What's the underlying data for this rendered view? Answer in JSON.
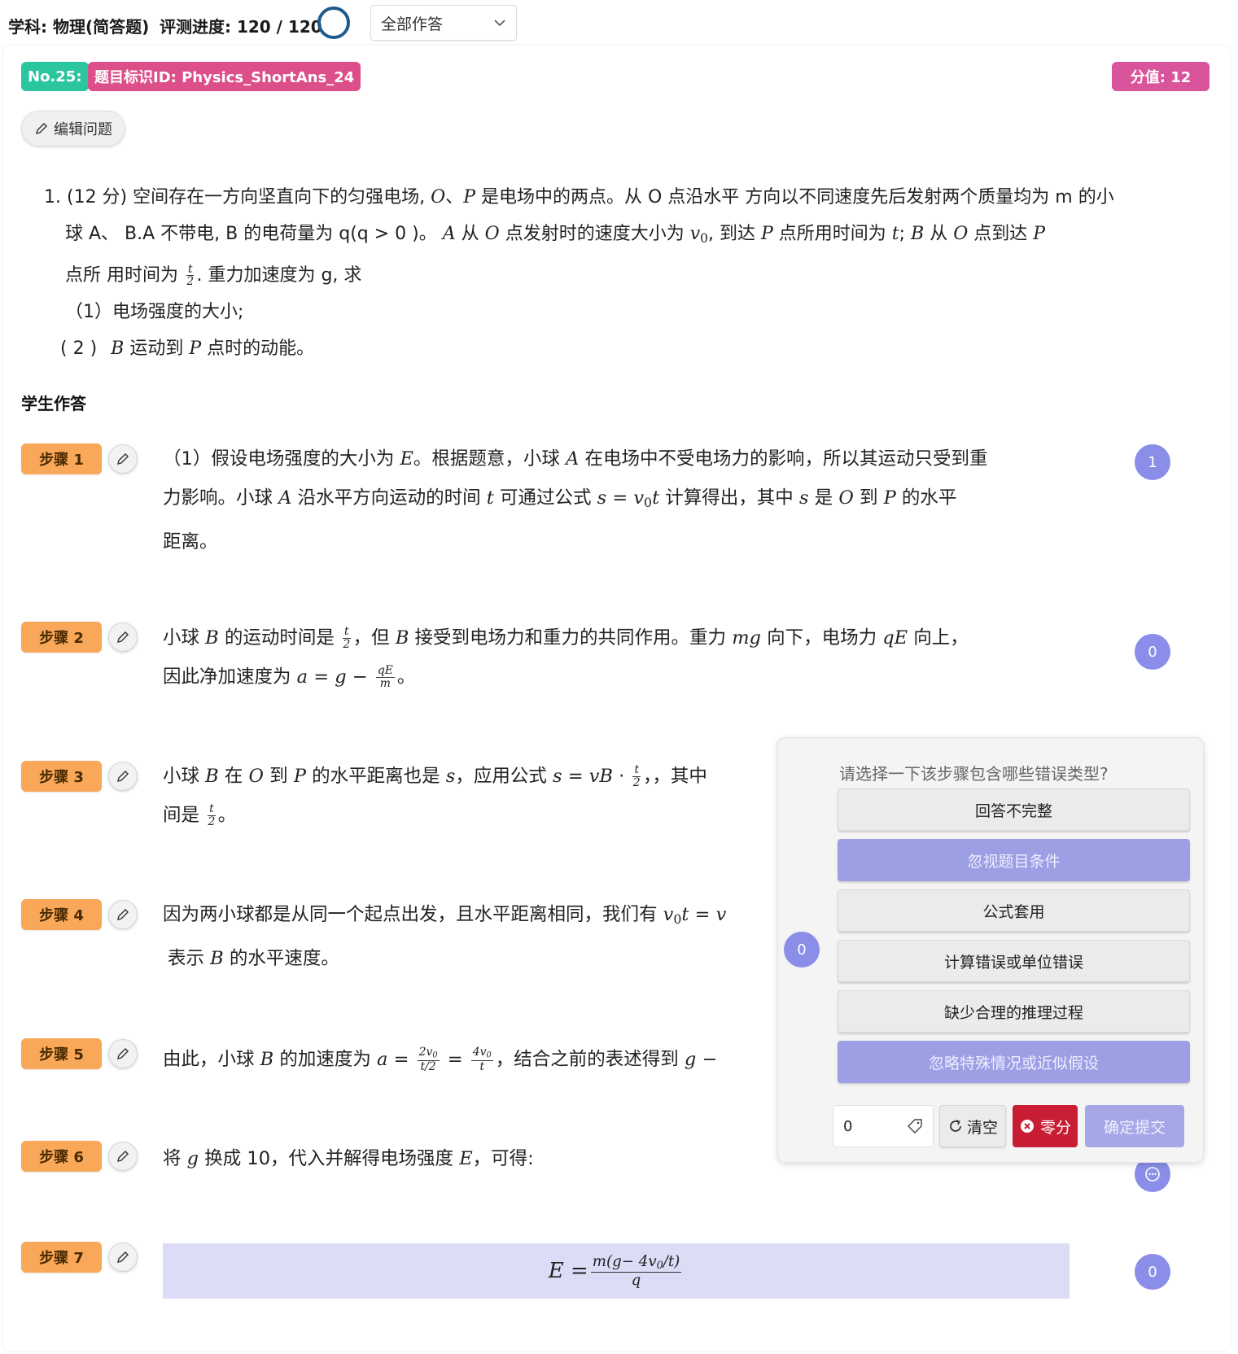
{
  "header": {
    "subject": "学科: 物理(简答题)",
    "progress": "评测进度: 120 / 120",
    "filter_value": "全部作答"
  },
  "question_card": {
    "number_tag": "No.25:",
    "id_tag": "题目标识ID: Physics_ShortAns_24",
    "score_tag": "分值: 12",
    "edit_button": "编辑问题"
  },
  "question": {
    "prefix": "1. (12 分) 空间存在一方向坚直向下的匀强电场,",
    "line1_b": "是电场中的两点。从 O 点沿水平 方向以不同速度先后发射两个质量均为 m 的小",
    "line2_a": "球 A、 B.A 不带电, B 的电荷量为 q(q > 0 )。",
    "line2_b": "从",
    "line2_c": "点发射时的速度大小为",
    "line2_d": ", 到达",
    "line2_e": "点所用时间为",
    "line2_f": "从",
    "line2_g": "点到达",
    "line3_a": "点所 用时间为",
    "line3_b": ". 重力加速度为 g, 求",
    "sub1": "（1）电场强度的大小;",
    "sub2_a": "( 2 )",
    "sub2_b": "运动到",
    "sub2_c": "点时的动能。"
  },
  "answers_title": "学生作答",
  "steps": [
    {
      "label": "步骤 1",
      "score": "1",
      "t1": "（1）假设电场强度的大小为",
      "t2": "。根据题意，小球",
      "t3": "在电场中不受电场力的影响，所以其运动只受到重",
      "t4": "力影响。小球",
      "t5": "沿水平方向运动的时间",
      "t6": "可通过公式",
      "t7": "计算得出，其中",
      "t8": "是",
      "t9": "到",
      "t10": "的水平",
      "t11": "距离。"
    },
    {
      "label": "步骤 2",
      "score": "0",
      "t1": "小球",
      "t2": "的运动时间是",
      "t3": "，但",
      "t4": "接受到电场力和重力的共同作用。重力",
      "t5": "向下，电场力",
      "t6": "向上，",
      "t7": "因此净加速度为"
    },
    {
      "label": "步骤 3",
      "t1": "小球",
      "t2": "在",
      "t3": "到",
      "t4": "的水平距离也是",
      "t5": "，应用公式",
      "t6": "，其中",
      "t7": "间是"
    },
    {
      "label": "步骤 4",
      "t1": "因为两小球都是从同一个起点出发，且水平距离相同，我们有",
      "t2": "表示",
      "t3": "的水平速度。"
    },
    {
      "label": "步骤 5",
      "t1": "由此，小球",
      "t2": "的加速度为",
      "t3": "，结合之前的表述得到"
    },
    {
      "label": "步骤 6",
      "t1": "将",
      "t2": "换成 10，代入并解得电场强度",
      "t3": "，可得:"
    },
    {
      "label": "步骤 7",
      "score": "0"
    }
  ],
  "error_popup": {
    "title": "请选择一下该步骤包含哪些错误类型?",
    "options": [
      {
        "label": "回答不完整",
        "selected": false
      },
      {
        "label": "忽视题目条件",
        "selected": true
      },
      {
        "label": "公式套用",
        "selected": false
      },
      {
        "label": "计算错误或单位错误",
        "selected": false
      },
      {
        "label": "缺少合理的推理过程",
        "selected": false
      },
      {
        "label": "忽略特殊情况或近似假设",
        "selected": true
      }
    ],
    "score_value": "0",
    "clear_label": "清空",
    "zero_label": "零分",
    "submit_label": "确定提交",
    "side_score": "0"
  },
  "colors": {
    "number_tag": "#2bc5a0",
    "id_tag": "#dc4f8a",
    "score_tag": "#d9549a",
    "step_badge": "#f9a85a",
    "score_circle": "#8a8ee8",
    "selected_option": "#9d9fe4",
    "zero_button": "#c81d32"
  }
}
